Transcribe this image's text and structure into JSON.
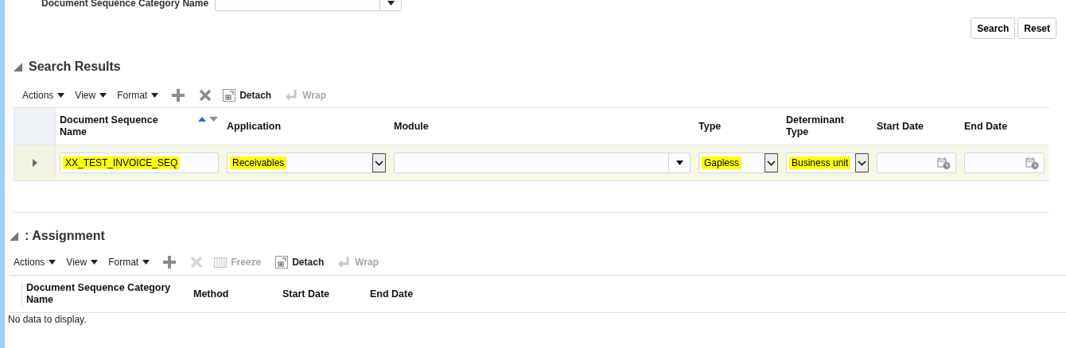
{
  "search_form": {
    "field_label": "Document Sequence Category Name",
    "buttons": [
      "Search",
      "Reset"
    ]
  },
  "search_results": {
    "title": "Search Results",
    "expanded": true,
    "toolbar": [
      {
        "kind": "menu",
        "label": "Actions"
      },
      {
        "kind": "menu",
        "label": "View"
      },
      {
        "kind": "menu",
        "label": "Format"
      },
      {
        "kind": "add",
        "disabled": false
      },
      {
        "kind": "delete",
        "disabled": false
      },
      {
        "kind": "detach",
        "label": "Detach",
        "disabled": false
      },
      {
        "kind": "wrap",
        "label": "Wrap",
        "disabled": true
      }
    ],
    "columns": [
      {
        "label": "Document Sequence Name",
        "sortable": true
      },
      {
        "label": "Application",
        "sortable": false
      },
      {
        "label": "Module",
        "sortable": false
      },
      {
        "label": "Type",
        "sortable": false
      },
      {
        "label": "Determinant Type",
        "sortable": false
      },
      {
        "label": "Start Date",
        "sortable": false
      },
      {
        "label": "End Date",
        "sortable": false
      }
    ],
    "rows": [
      {
        "selected": true,
        "expanded": false,
        "cells": [
          {
            "kind": "text",
            "value": "XX_TEST_INVOICE_SEQ",
            "highlighted": true
          },
          {
            "kind": "select",
            "value": "Receivables",
            "highlighted": true
          },
          {
            "kind": "choice"
          },
          {
            "kind": "select",
            "value": "Gapless",
            "highlighted": true
          },
          {
            "kind": "select",
            "value": "Business unit",
            "highlighted": true
          },
          {
            "kind": "date"
          },
          {
            "kind": "date"
          }
        ]
      }
    ]
  },
  "assignment": {
    "title": ": Assignment",
    "expanded": true,
    "toolbar": [
      {
        "kind": "menu",
        "label": "Actions"
      },
      {
        "kind": "menu",
        "label": "View"
      },
      {
        "kind": "menu",
        "label": "Format"
      },
      {
        "kind": "add",
        "disabled": false
      },
      {
        "kind": "delete",
        "disabled": true
      },
      {
        "kind": "freeze",
        "label": "Freeze",
        "disabled": true
      },
      {
        "kind": "detach",
        "label": "Detach",
        "disabled": false
      },
      {
        "kind": "wrap",
        "label": "Wrap",
        "disabled": true
      }
    ],
    "columns": [
      {
        "label": "Document Sequence Category Name"
      },
      {
        "label": "Method"
      },
      {
        "label": "Start Date"
      },
      {
        "label": "End Date"
      }
    ],
    "empty_message": "No data to display."
  }
}
